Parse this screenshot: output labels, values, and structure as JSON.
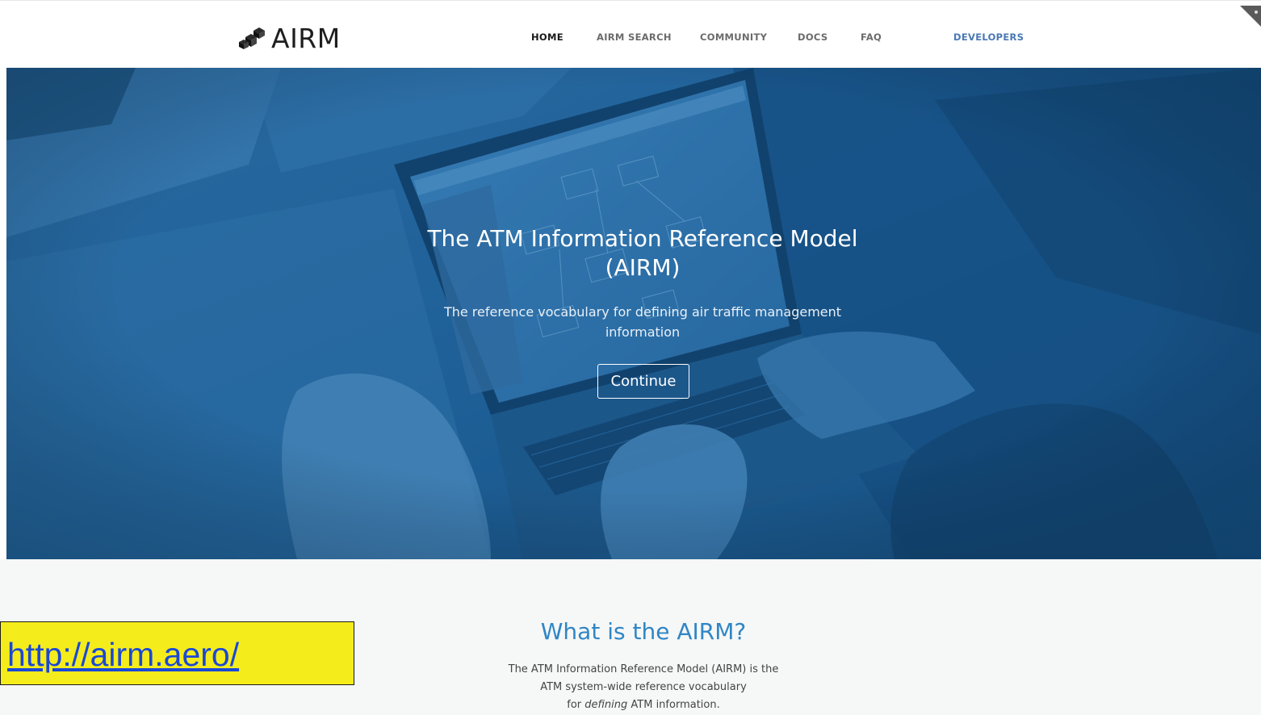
{
  "header": {
    "logo_text": "AIRM",
    "nav": {
      "home": "HOME",
      "airm_search": "AIRM SEARCH",
      "community": "COMMUNITY",
      "docs": "DOCS",
      "faq": "FAQ",
      "developers": "DEVELOPERS"
    }
  },
  "hero": {
    "title_line1": "The ATM Information Reference Model",
    "title_line2": "(AIRM)",
    "subtitle_line1": "The reference vocabulary for defining air traffic management",
    "subtitle_line2": "information",
    "continue_label": "Continue"
  },
  "section": {
    "title": "What is the AIRM?",
    "desc_line1": "The ATM Information Reference Model (AIRM) is the",
    "desc_line2": "ATM system-wide reference vocabulary",
    "desc_line3_pre": "for ",
    "desc_line3_em": "defining",
    "desc_line3_post": " ATM information."
  },
  "callout": {
    "url": "http://airm.aero/"
  },
  "colors": {
    "hero_blue": "#1d5f94",
    "accent_blue": "#2f86c6",
    "developers_link": "#4a78b4",
    "callout_yellow": "#f5ec1c",
    "url_blue": "#1a48d6"
  }
}
